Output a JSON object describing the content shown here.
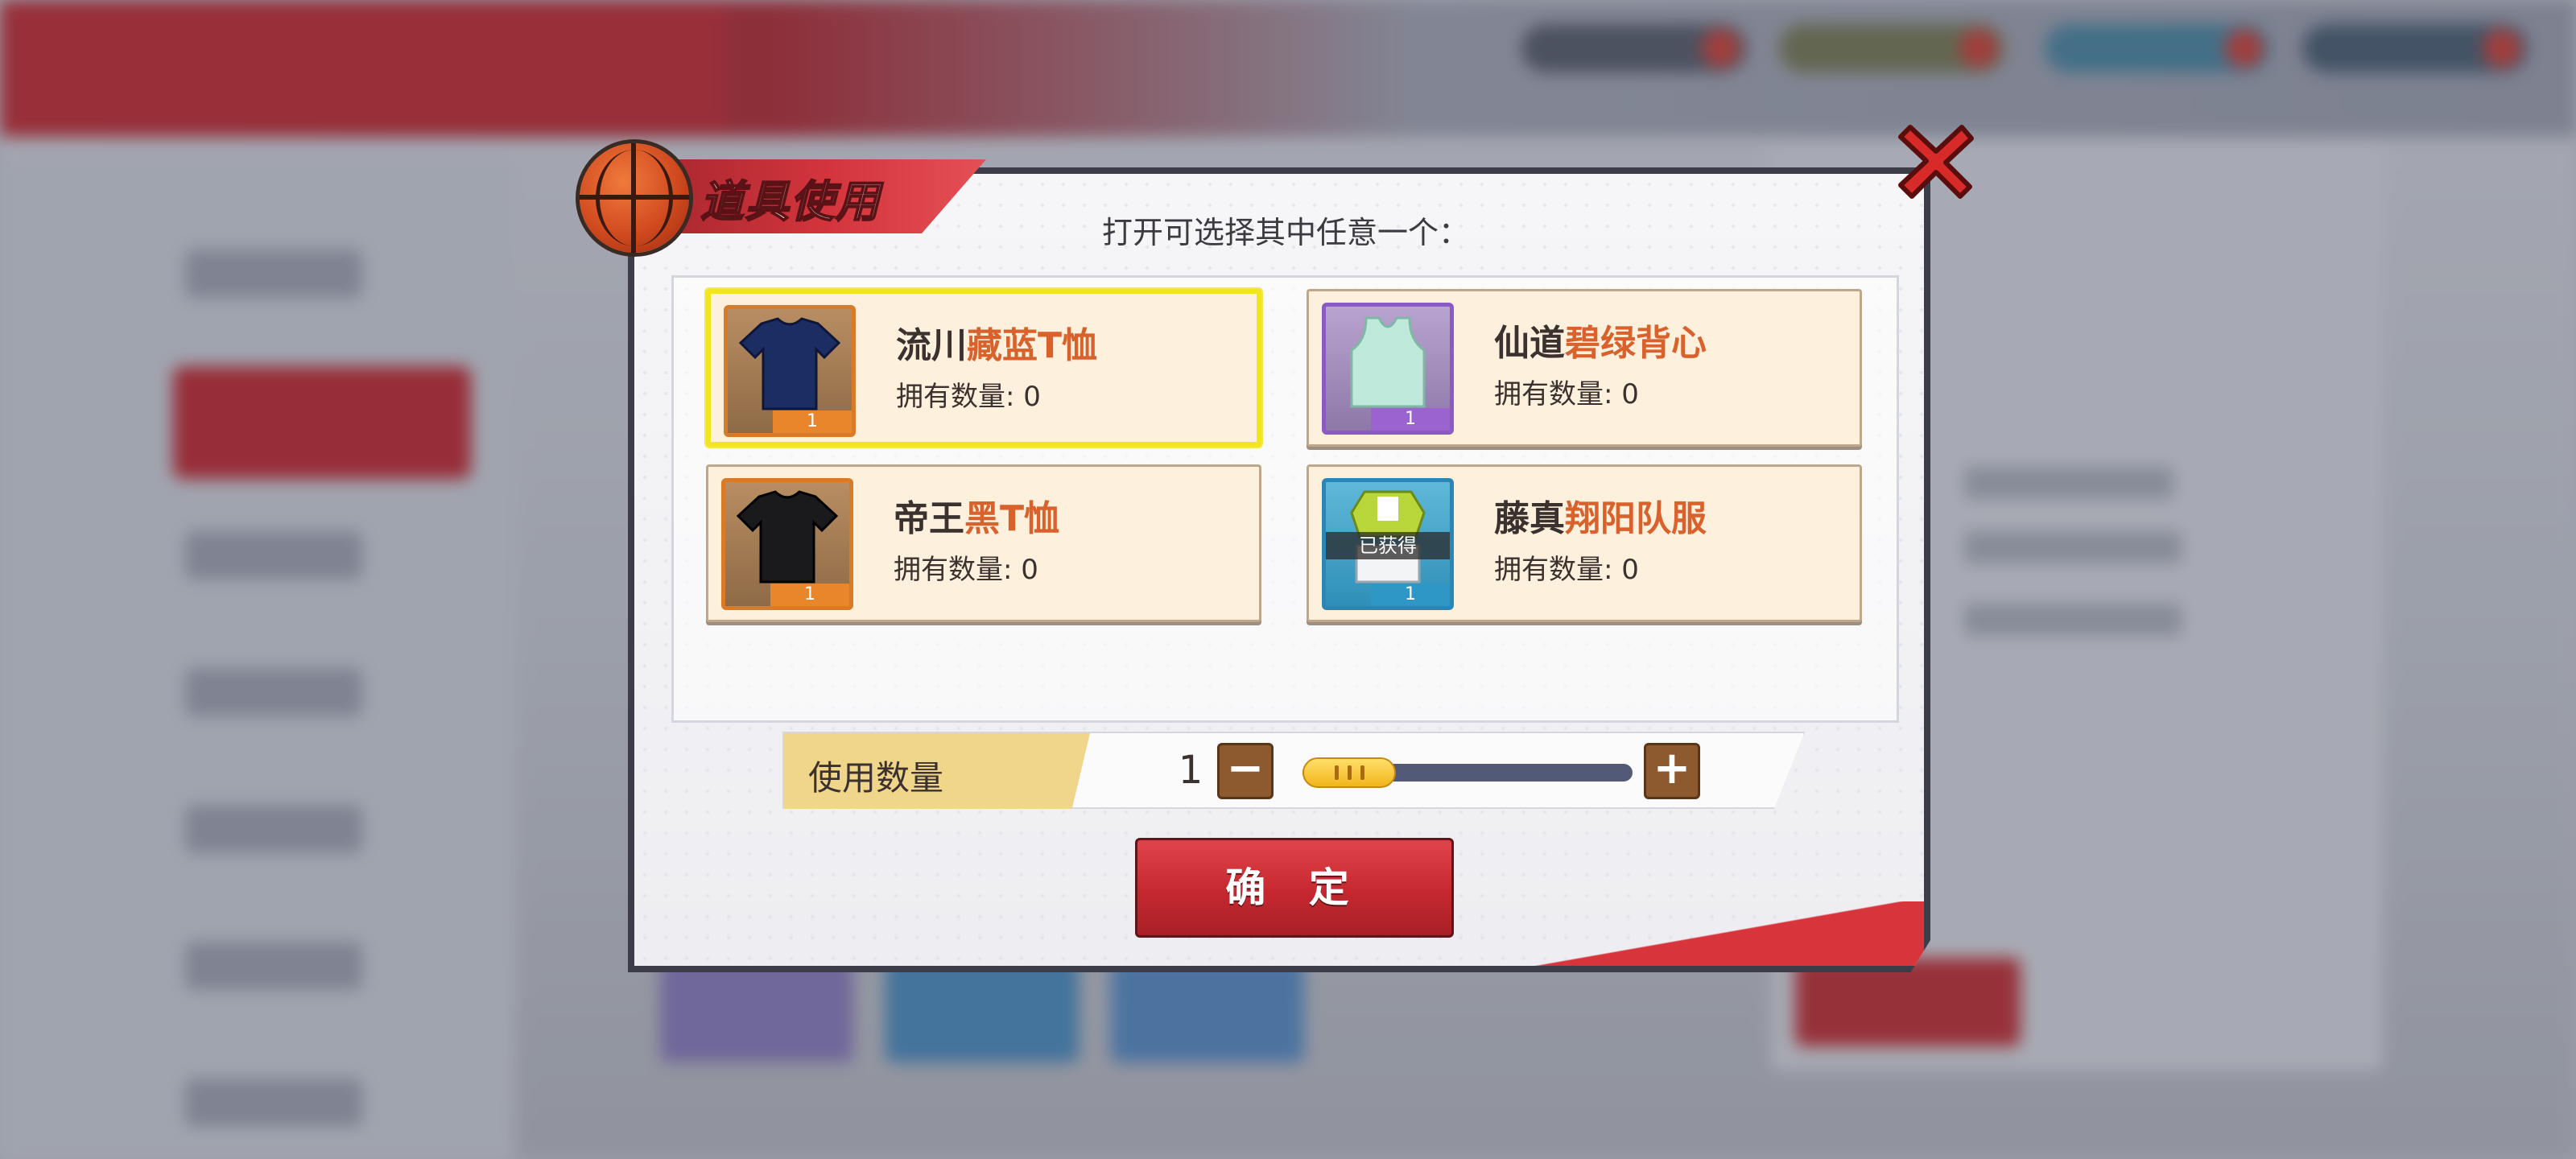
{
  "dialog": {
    "title": "道具使用",
    "subtitle": "打开可选择其中任意一个：",
    "confirm_label": "确 定",
    "close_icon": "close-icon"
  },
  "items": [
    {
      "name_prefix": "流川",
      "name_highlight": "藏蓝T恤",
      "count_label": "拥有数量: 0",
      "stack": "1",
      "rarity_color": "#d97a26",
      "selected": true,
      "icon": "navy-tshirt-icon"
    },
    {
      "name_prefix": "仙道",
      "name_highlight": "碧绿背心",
      "count_label": "拥有数量: 0",
      "stack": "1",
      "rarity_color": "#8b5ac3",
      "selected": false,
      "icon": "green-vest-icon"
    },
    {
      "name_prefix": "帝王",
      "name_highlight": "黑T恤",
      "count_label": "拥有数量: 0",
      "stack": "1",
      "rarity_color": "#d97a26",
      "selected": false,
      "icon": "black-tshirt-icon"
    },
    {
      "name_prefix": "藤真",
      "name_highlight": "翔阳队服",
      "count_label": "拥有数量: 0",
      "stack": "1",
      "rarity_color": "#2a86b4",
      "selected": false,
      "icon": "team-uniform-icon",
      "owned_badge": "已获得"
    }
  ],
  "quantity": {
    "label": "使用数量",
    "value": "1",
    "slider_fraction": 0.0,
    "minus_symbol": "−",
    "plus_symbol": "+"
  },
  "colors": {
    "accent_red": "#d3343c",
    "highlight_text": "#d8612c",
    "selected_border": "#f3e51b"
  }
}
